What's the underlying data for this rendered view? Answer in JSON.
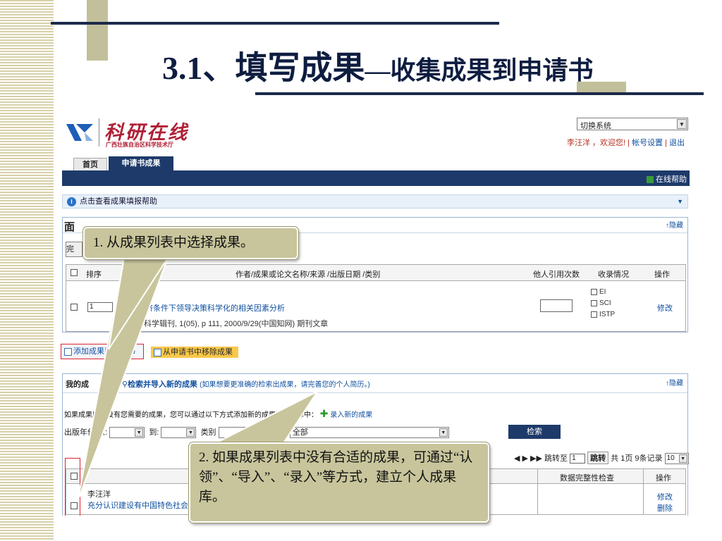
{
  "slide": {
    "title_main": "3.1、填写成果",
    "title_sub": "—收集成果到申请书"
  },
  "app": {
    "logo": {
      "name": "科研在线",
      "subtitle": "广西壮族自治区科学技术厅"
    },
    "system_switch": "切换系统",
    "userbar": {
      "greeting": "李汪洋 ，欢迎您! | ",
      "account": "帐号设置",
      "sep": " | ",
      "logout": "退出"
    },
    "tabs": [
      {
        "label": "首页"
      },
      {
        "label": "申请书成果"
      }
    ],
    "help": "在线帮助",
    "info_bar": "点击查看成果填报帮助",
    "panel1": {
      "title": "面",
      "hide": "↑隐藏",
      "complete_btn": "完",
      "headers": {
        "order": "排序",
        "main": "作者/成果或论文名称/来源 /出版日期 /类别",
        "cite": "他人引用次数",
        "index": "收录情况",
        "op": "操作"
      },
      "row": {
        "rank": "1",
        "title": "济条件下领导决策科学化的相关因素分析",
        "source": "科学辑刊, 1(05), p 111, 2000/9/29(中国知网) 期刊文章",
        "indexes": [
          "EI",
          "SCI",
          "ISTP"
        ],
        "op": "修改"
      }
    },
    "buttons": {
      "add": "添加成果到申请书",
      "remove": "从申请书中移除成果"
    },
    "panel2": {
      "tab_my": "我的成",
      "tab_search": "检索并导入新的成果",
      "tab_search_note": "(如果想要更准确的检索出成果，请完善您的个人简历。)",
      "hide": "↑隐藏",
      "hint": "如果成果库中没有您需要的成果，您可以通过以下方式添加新的成果到成果库中：",
      "add_new": "录入新的成果",
      "filter": {
        "year_label": "出版年份 从:",
        "to_label": "到:",
        "type_label": "类别",
        "source_label": "来源",
        "source_value": "全部"
      },
      "search_btn": "检索",
      "pager": {
        "goto": "跳转至",
        "page_value": "1",
        "jump": "跳转",
        "summary": "共 1页 9条记录",
        "page_size": "10"
      },
      "headers": {
        "check": "数据完整性检查",
        "op": "操作"
      },
      "row": {
        "author": "李汪洋",
        "title": "充分认识建设有中国特色社会",
        "modify": "修改",
        "delete": "删除"
      }
    }
  },
  "callouts": {
    "c1": "1. 从成果列表中选择成果。",
    "c2": "2. 如果成果列表中没有合适的成果，可通过“认领”、“导入”、“录入”等方式，建立个人成果库。"
  }
}
